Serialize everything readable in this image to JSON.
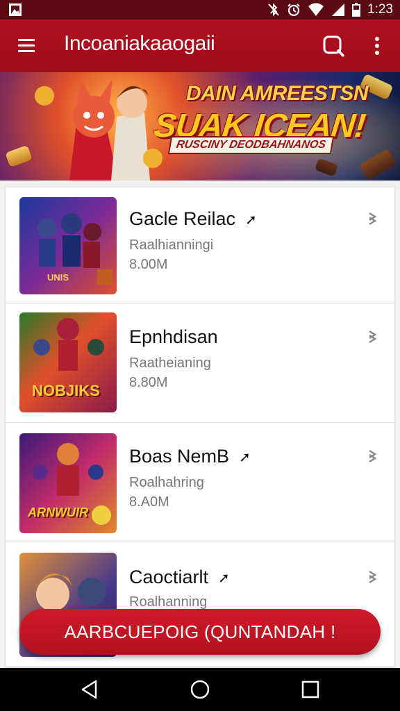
{
  "status_bar": {
    "time": "1:23",
    "icons": [
      "image-icon",
      "bluetooth-off-icon",
      "alarm-icon",
      "wifi-icon",
      "signal-icon",
      "battery-icon"
    ]
  },
  "app_bar": {
    "title": "Incoaniakaaogaii",
    "icons": [
      "menu-icon",
      "search-icon",
      "more-vert-icon"
    ],
    "color": "#b01020"
  },
  "banner": {
    "headline_1": "DAIN AMREESTSN",
    "headline_2": "SUAK ICEAN!",
    "subtitle": "RUSCINY DEODBAHNANOS"
  },
  "games": [
    {
      "name": "Gacle Reilac",
      "category": "Raalhianningi",
      "size": "8.00M",
      "thumb_text": "UNIS"
    },
    {
      "name": "Epnhdisan",
      "category": "Raatheianing",
      "size": "8.80M",
      "thumb_text": "NOBJIKS"
    },
    {
      "name": "Boas NemB",
      "category": "Roalhahring",
      "size": "8.A0M",
      "thumb_text": "ARNWUIR"
    },
    {
      "name": "Caoctiarlt",
      "category": "Roalhanning",
      "size": "",
      "thumb_text": ""
    }
  ],
  "cta": {
    "label": "AARBCUEPOIG (QUNTANDAH !"
  },
  "navbar": {
    "icons": [
      "back-icon",
      "home-icon",
      "recents-icon"
    ]
  }
}
